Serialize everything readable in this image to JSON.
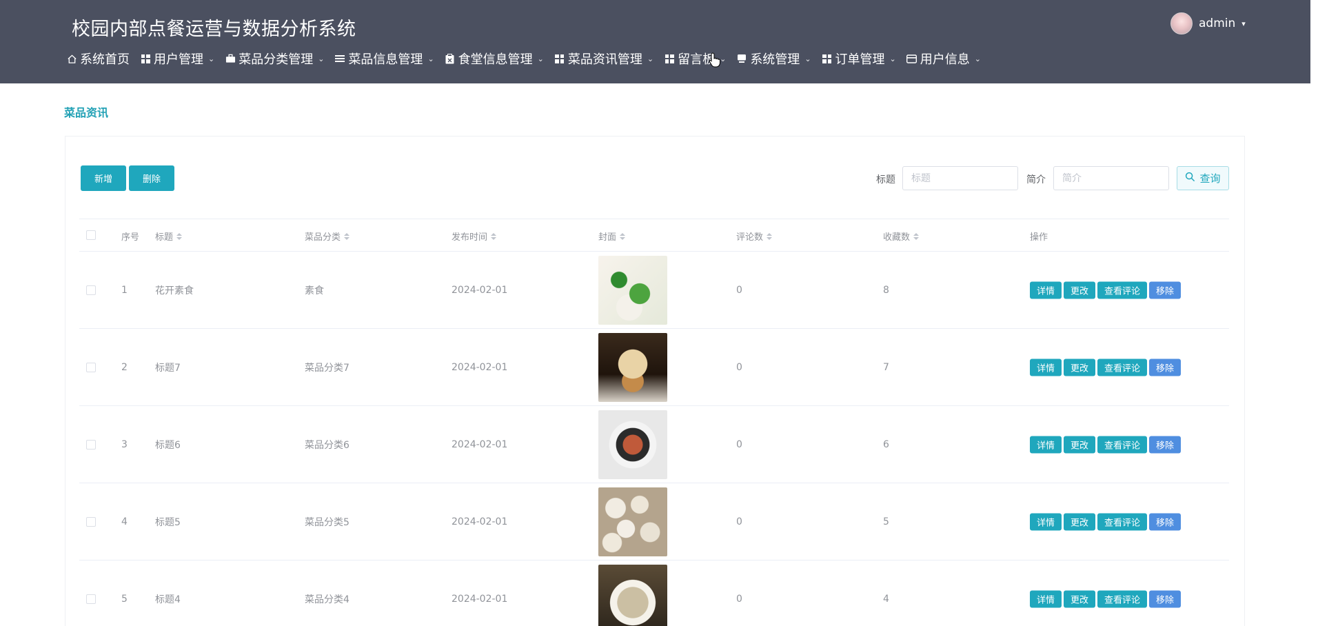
{
  "app": {
    "title": "校园内部点餐运营与数据分析系统"
  },
  "user": {
    "name": "admin"
  },
  "nav": [
    {
      "label": "系统首页",
      "icon": "home-icon",
      "has_menu": false
    },
    {
      "label": "用户管理",
      "icon": "grid-icon",
      "has_menu": true
    },
    {
      "label": "菜品分类管理",
      "icon": "briefcase-icon",
      "has_menu": true
    },
    {
      "label": "菜品信息管理",
      "icon": "list-icon",
      "has_menu": true
    },
    {
      "label": "食堂信息管理",
      "icon": "clipboard-icon",
      "has_menu": true
    },
    {
      "label": "菜品资讯管理",
      "icon": "grid-icon",
      "has_menu": true
    },
    {
      "label": "留言板",
      "icon": "grid-icon",
      "has_menu": true
    },
    {
      "label": "系统管理",
      "icon": "monitor-icon",
      "has_menu": true
    },
    {
      "label": "订单管理",
      "icon": "grid-icon",
      "has_menu": true
    },
    {
      "label": "用户信息",
      "icon": "card-icon",
      "has_menu": true
    }
  ],
  "breadcrumb": "菜品资讯",
  "toolbar": {
    "add_label": "新增",
    "delete_label": "删除"
  },
  "search": {
    "title_label": "标题",
    "title_placeholder": "标题",
    "intro_label": "简介",
    "intro_placeholder": "简介",
    "query_label": "查询"
  },
  "table": {
    "headers": {
      "index": "序号",
      "title": "标题",
      "category": "菜品分类",
      "publish_time": "发布时间",
      "cover": "封面",
      "comments": "评论数",
      "favorites": "收藏数",
      "actions": "操作"
    },
    "actions": {
      "detail": "详情",
      "edit": "更改",
      "view_comments": "查看评论",
      "remove": "移除"
    },
    "rows": [
      {
        "index": "1",
        "title": "花开素食",
        "category": "素食",
        "publish_time": "2024-02-01",
        "comments": "0",
        "favorites": "8"
      },
      {
        "index": "2",
        "title": "标题7",
        "category": "菜品分类7",
        "publish_time": "2024-02-01",
        "comments": "0",
        "favorites": "7"
      },
      {
        "index": "3",
        "title": "标题6",
        "category": "菜品分类6",
        "publish_time": "2024-02-01",
        "comments": "0",
        "favorites": "6"
      },
      {
        "index": "4",
        "title": "标题5",
        "category": "菜品分类5",
        "publish_time": "2024-02-01",
        "comments": "0",
        "favorites": "5"
      },
      {
        "index": "5",
        "title": "标题4",
        "category": "菜品分类4",
        "publish_time": "2024-02-01",
        "comments": "0",
        "favorites": "4"
      }
    ]
  },
  "colors": {
    "header_bg": "#4b5060",
    "accent": "#1fa7bd",
    "remove_button": "#4f8ee0"
  }
}
